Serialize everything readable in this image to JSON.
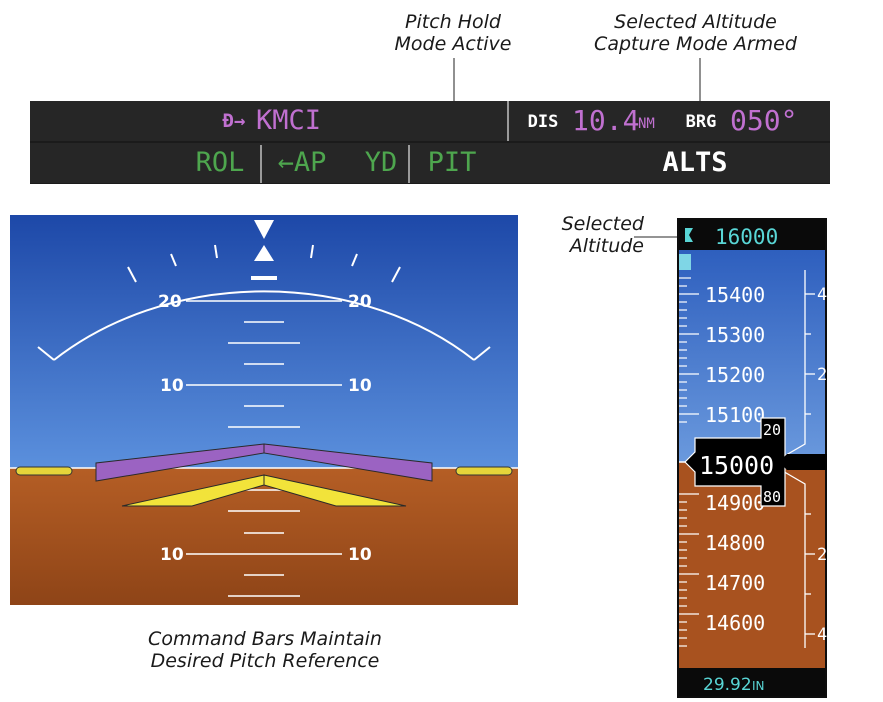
{
  "callouts": {
    "pitch_hold": [
      "Pitch Hold",
      "Mode Active"
    ],
    "alt_capture": [
      "Selected Altitude",
      "Capture Mode Armed"
    ],
    "selected_altitude": [
      "Selected",
      "Altitude"
    ],
    "command_bars": [
      "Command Bars Maintain",
      "Desired Pitch Reference"
    ]
  },
  "nav_status": {
    "direct_to_symbol": "Đ→",
    "waypoint": "KMCI",
    "dis_label": "DIS",
    "dis_value": "10.4",
    "dis_unit": "NM",
    "brg_label": "BRG",
    "brg_value": "050°"
  },
  "afcs_status": {
    "lateral_active": "ROL",
    "ap_indicator": "←AP",
    "yd_indicator": "YD",
    "vertical_active": "PIT",
    "vertical_armed": "ALTS"
  },
  "attitude": {
    "pitch_labels": [
      {
        "left": "20",
        "right": "20"
      },
      {
        "left": "10",
        "right": "10"
      },
      {
        "left": "10",
        "right": "10"
      }
    ]
  },
  "altimeter": {
    "selected_altitude": "16000",
    "tape_values": [
      "15400",
      "15300",
      "15200",
      "15100",
      "14900",
      "14800",
      "14700",
      "14600"
    ],
    "current_altitude_major": "15",
    "current_altitude_minor": "000",
    "roll_above": "20",
    "roll_below": "80",
    "trend_marks_upper": [
      "4",
      "2"
    ],
    "trend_marks_lower": [
      "2",
      "4"
    ],
    "baro_setting": "29.92",
    "baro_unit": "IN"
  },
  "colors": {
    "sky": "#2f60b8",
    "ground": "#a8521f",
    "magenta": "#c070d0",
    "green": "#4ea64e",
    "cyan": "#59d6d6",
    "white": "#ffffff",
    "command_bars": "#f2e33a",
    "aircraft_symbol": "#9b63c2"
  }
}
